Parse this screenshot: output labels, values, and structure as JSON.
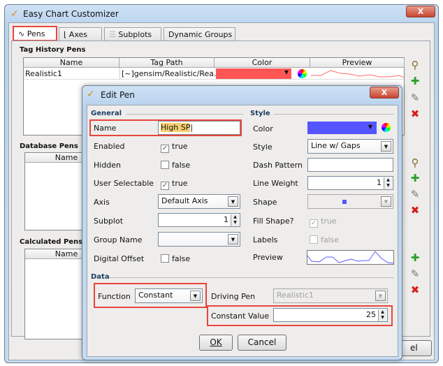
{
  "main_window": {
    "title": "Easy Chart Customizer",
    "close_label": "X",
    "tabs": [
      {
        "label": "Pens",
        "icon": "pen-line-icon"
      },
      {
        "label": "Axes",
        "icon": "axes-icon"
      },
      {
        "label": "Subplots",
        "icon": "subplots-icon"
      },
      {
        "label": "Dynamic Groups"
      }
    ],
    "tag_history": {
      "title": "Tag History Pens",
      "columns": [
        "Name",
        "Tag Path",
        "Color",
        "Preview"
      ],
      "rows": [
        {
          "name": "Realistic1",
          "tag_path": "[~]gensim/Realistic/Rea...",
          "color": "#ff5555"
        }
      ]
    },
    "database_pens": {
      "title": "Database Pens",
      "columns": [
        "Name"
      ]
    },
    "calculated_pens": {
      "title": "Calculated Pens",
      "columns": [
        "Name"
      ]
    },
    "partial_button": "el"
  },
  "dialog": {
    "title": "Edit Pen",
    "close_label": "X",
    "general": {
      "title": "General",
      "name_label": "Name",
      "name_value": "High SP",
      "enabled_label": "Enabled",
      "enabled_value": "true",
      "enabled_checked": true,
      "hidden_label": "Hidden",
      "hidden_value": "false",
      "hidden_checked": false,
      "user_selectable_label": "User Selectable",
      "user_selectable_value": "true",
      "user_selectable_checked": true,
      "axis_label": "Axis",
      "axis_value": "Default Axis",
      "subplot_label": "Subplot",
      "subplot_value": "1",
      "group_name_label": "Group Name",
      "group_name_value": "",
      "digital_offset_label": "Digital Offset",
      "digital_offset_value": "false",
      "digital_offset_checked": false
    },
    "style": {
      "title": "Style",
      "color_label": "Color",
      "color_value": "#5555ff",
      "style_label": "Style",
      "style_value": "Line w/ Gaps",
      "dash_label": "Dash Pattern",
      "dash_value": "",
      "weight_label": "Line Weight",
      "weight_value": "1",
      "shape_label": "Shape",
      "fill_label": "Fill Shape?",
      "fill_value": "true",
      "labels_label": "Labels",
      "labels_value": "false",
      "preview_label": "Preview"
    },
    "data": {
      "title": "Data",
      "function_label": "Function",
      "function_value": "Constant",
      "driving_label": "Driving Pen",
      "driving_value": "Realistic1",
      "constant_label": "Constant Value",
      "constant_value": "25"
    },
    "ok_label": "OK",
    "cancel_label": "Cancel"
  },
  "colors": {
    "highlight": "#e8453c",
    "pen_red": "#ff5555",
    "pen_blue": "#5555ff"
  }
}
